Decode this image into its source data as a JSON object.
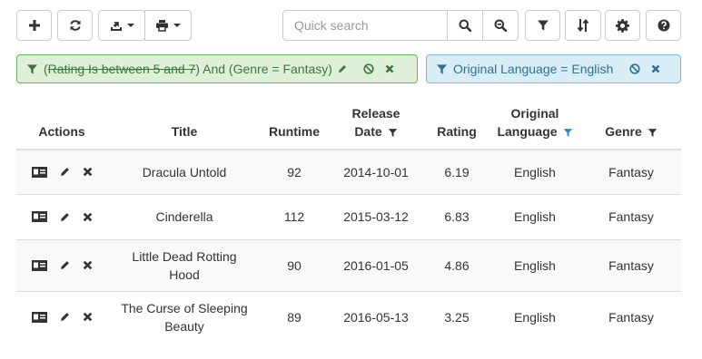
{
  "toolbar": {
    "search_placeholder": "Quick search"
  },
  "filters": {
    "primary": {
      "prefix": "(",
      "struck": "Rating Is between 5 and 7",
      "rest": ") And (Genre = Fantasy)"
    },
    "secondary": {
      "label": "Original Language = English"
    }
  },
  "table": {
    "columns": {
      "actions": "Actions",
      "title": "Title",
      "runtime": "Runtime",
      "release_date_1": "Release",
      "release_date_2": "Date",
      "rating": "Rating",
      "language_1": "Original",
      "language_2": "Language",
      "genre": "Genre"
    },
    "rows": [
      {
        "title_1": "Dracula Untold",
        "title_2": "",
        "runtime": "92",
        "release_date": "2014-10-01",
        "rating": "6.19",
        "language": "English",
        "genre": "Fantasy"
      },
      {
        "title_1": "Cinderella",
        "title_2": "",
        "runtime": "112",
        "release_date": "2015-03-12",
        "rating": "6.83",
        "language": "English",
        "genre": "Fantasy"
      },
      {
        "title_1": "Little Dead Rotting",
        "title_2": "Hood",
        "runtime": "90",
        "release_date": "2016-01-05",
        "rating": "4.86",
        "language": "English",
        "genre": "Fantasy"
      },
      {
        "title_1": "The Curse of Sleeping",
        "title_2": "Beauty",
        "runtime": "89",
        "release_date": "2016-05-13",
        "rating": "3.25",
        "language": "English",
        "genre": "Fantasy"
      }
    ]
  },
  "colors": {
    "filter_green_bg": "#dff0d8",
    "filter_green_text": "#3c763d",
    "filter_blue_bg": "#d9edf7",
    "filter_blue_text": "#31708f",
    "active_filter_icon": "#3a87c8"
  }
}
